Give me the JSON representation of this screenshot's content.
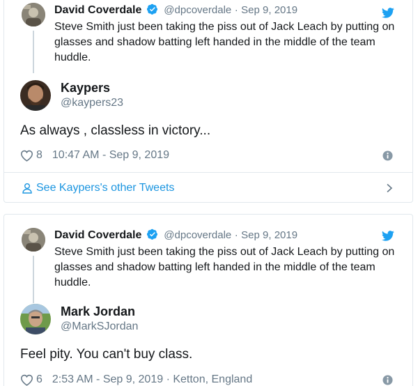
{
  "embeds": [
    {
      "parent": {
        "name": "David Coverdale",
        "handle": "@dpcoverdale",
        "separator": "·",
        "date": "Sep 9, 2019",
        "text": "Steve Smith just been taking the piss out of Jack Leach by putting on glasses and shadow batting left handed in the middle of the team huddle."
      },
      "reply": {
        "name": "Kaypers",
        "handle": "@kaypers23",
        "text": "As always , classless in victory..."
      },
      "likes": "8",
      "timestamp": "10:47 AM - Sep 9, 2019",
      "footer_link": "See Kaypers's other Tweets"
    },
    {
      "parent": {
        "name": "David Coverdale",
        "handle": "@dpcoverdale",
        "separator": "·",
        "date": "Sep 9, 2019",
        "text": "Steve Smith just been taking the piss out of Jack Leach by putting on glasses and shadow batting left handed in the middle of the team huddle."
      },
      "reply": {
        "name": "Mark Jordan",
        "handle": "@MarkSJordan",
        "text": "Feel pity. You can't buy class."
      },
      "likes": "6",
      "timestamp": "2:53 AM - Sep 9, 2019 · Ketton, England"
    }
  ],
  "colors": {
    "twitter_blue": "#1da1f2",
    "link_blue": "#1b95e0",
    "text": "#14171a",
    "muted": "#657786",
    "border": "#e1e8ed"
  },
  "icons": [
    "twitter-bird-icon",
    "verified-badge-icon",
    "heart-icon",
    "info-icon",
    "person-icon",
    "chevron-right-icon"
  ]
}
